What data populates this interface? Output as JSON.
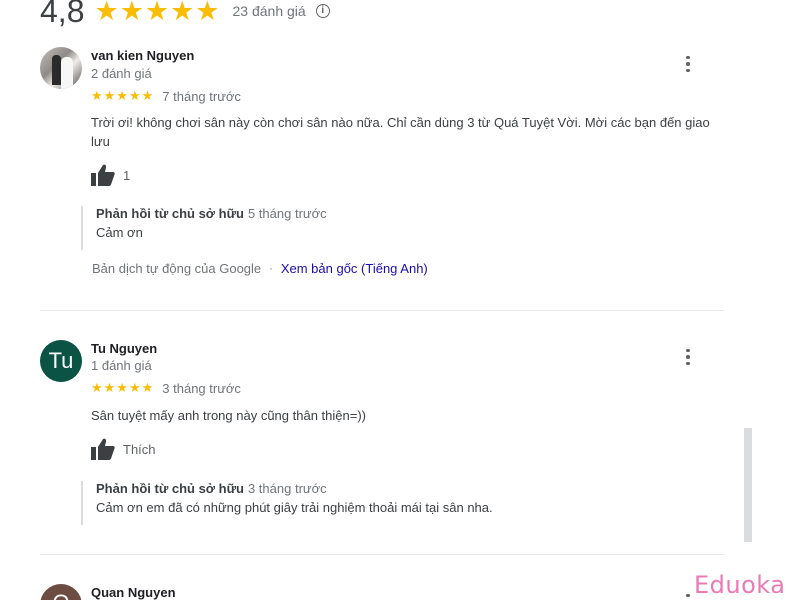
{
  "summary": {
    "score": "4,8",
    "stars": "★★★★★",
    "count": "23 đánh giá",
    "info_icon": "info-icon"
  },
  "reviews": [
    {
      "author": "van kien Nguyen",
      "meta": "2 đánh giá",
      "stars": "★★★★★",
      "time": "7 tháng trước",
      "text": "Trời ơi! không chơi sân này còn chơi sân  nào nữa. Chỉ cần dùng 3 từ Quá Tuyệt Vời. Mời các bạn đến giao lưu",
      "like_label": "1",
      "reply": {
        "title": "Phản hồi từ chủ sở hữu",
        "time": "5 tháng trước",
        "text": "Cảm ơn"
      },
      "translation_note": "Bản dịch tự động của Google",
      "translation_separator": "·",
      "see_original": "Xem bản gốc (Tiếng Anh)"
    },
    {
      "author": "Tu Nguyen",
      "avatar_letter": "Tu",
      "meta": "1 đánh giá",
      "stars": "★★★★★",
      "time": "3 tháng trước",
      "text": "Sân tuyệt mấy anh trong này cũng thân thiện=))",
      "like_label": "Thích",
      "reply": {
        "title": "Phản hồi từ chủ sở hữu",
        "time": "3 tháng trước",
        "text": "Cảm ơn em đã có những phút giây trải nghiệm thoải mái tại sân nha."
      }
    },
    {
      "author": "Quan Nguyen",
      "avatar_letter": "Q"
    }
  ],
  "watermark": "Eduoka",
  "colors": {
    "star": "#fbbc04",
    "link": "#1a0dab",
    "avatar_tu": "#0b5345",
    "watermark": "#e97bb4"
  }
}
